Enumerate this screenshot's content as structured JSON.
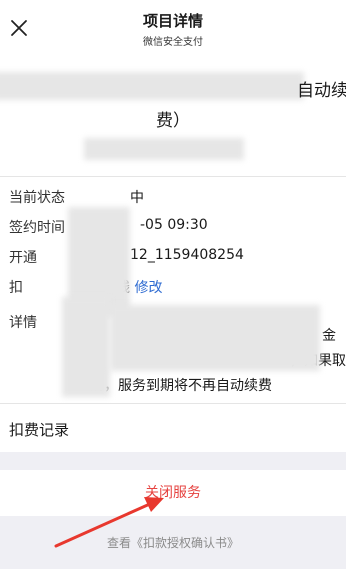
{
  "nav": {
    "close_icon": "close-icon",
    "title": "项目详情",
    "subtitle": "微信安全支付"
  },
  "header": {
    "title_line1_tail": "自动续",
    "title_line2": "费）"
  },
  "info": {
    "status_label": "当前状态",
    "status_value": "中",
    "sign_time_label": "签约时间",
    "sign_time_value": "-05 09:30",
    "open_label": "开通",
    "open_value": "12_1159408254",
    "pay_method_label": "扣",
    "pay_method_value": "线",
    "pay_method_edit": "修改",
    "detail_label": "详情",
    "detail_line1_tail": "金",
    "detail_line2_tail": "，如果取",
    "detail_line3": "消，服务到期将不再自动续费"
  },
  "records": {
    "label": "扣费记录"
  },
  "actions": {
    "close_service": "关闭服务",
    "view_agreement": "查看《扣款授权确认书》"
  },
  "colors": {
    "danger": "#e64340",
    "link": "#2e6bd1",
    "page_bg": "#efeff4"
  }
}
